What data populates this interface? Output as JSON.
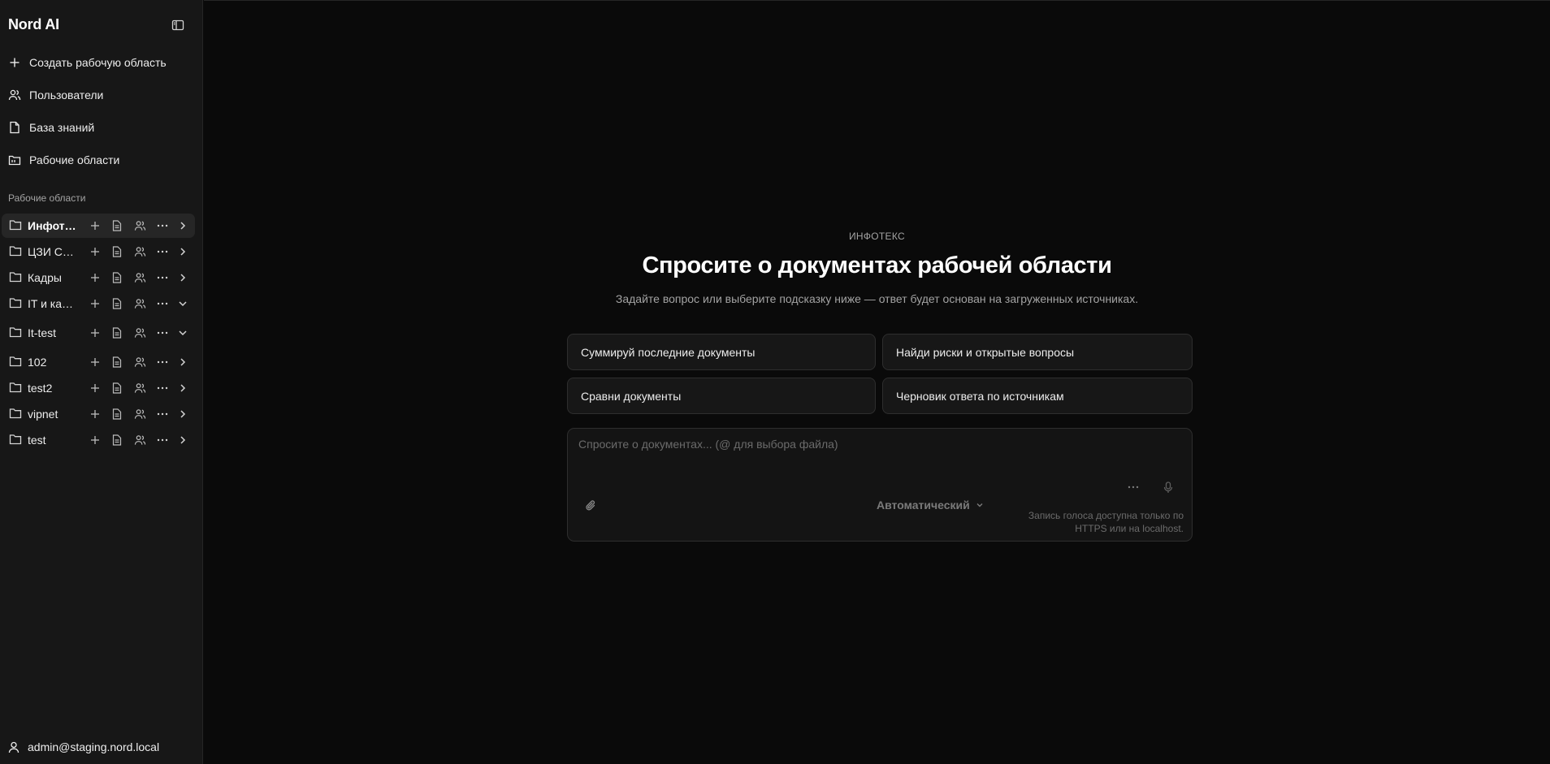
{
  "sidebar": {
    "brand": "Nord AI",
    "nav": [
      {
        "label": "Создать рабочую область",
        "icon": "plus-icon"
      },
      {
        "label": "Пользователи",
        "icon": "users-icon"
      },
      {
        "label": "База знаний",
        "icon": "file-icon"
      },
      {
        "label": "Рабочие области",
        "icon": "folders-icon"
      }
    ],
    "section_label": "Рабочие области",
    "workspaces": [
      {
        "name": "Инфотекс",
        "active": true,
        "expanded": false
      },
      {
        "name": "ЦЗИ Сертификация",
        "active": false,
        "expanded": false
      },
      {
        "name": "Кадры",
        "active": false,
        "expanded": false
      },
      {
        "name": "IT и кадры",
        "active": false,
        "expanded": true
      },
      {
        "name": "It-test",
        "active": false,
        "expanded": true
      },
      {
        "name": "102",
        "active": false,
        "expanded": false
      },
      {
        "name": "test2",
        "active": false,
        "expanded": false
      },
      {
        "name": "vipnet",
        "active": false,
        "expanded": false
      },
      {
        "name": "test",
        "active": false,
        "expanded": false
      }
    ],
    "user": "admin@staging.nord.local"
  },
  "main": {
    "overline": "ИНФОТЕКС",
    "title": "Спросите о документах рабочей области",
    "subtitle": "Задайте вопрос или выберите подсказку ниже — ответ будет основан на загруженных источниках.",
    "suggestions": [
      "Суммируй последние документы",
      "Найди риски и открытые вопросы",
      "Сравни документы",
      "Черновик ответа по источникам"
    ],
    "composer": {
      "placeholder": "Спросите о документах... (@ для выбора файла)",
      "mode": "Автоматический",
      "voice_note_line1": "Запись голоса доступна только по",
      "voice_note_line2": "HTTPS или на localhost."
    }
  },
  "colors": {
    "background": "#0a0a0a",
    "sidebar": "#171717",
    "card": "#171717",
    "text": "#ededed",
    "muted": "#a3a3a3"
  }
}
